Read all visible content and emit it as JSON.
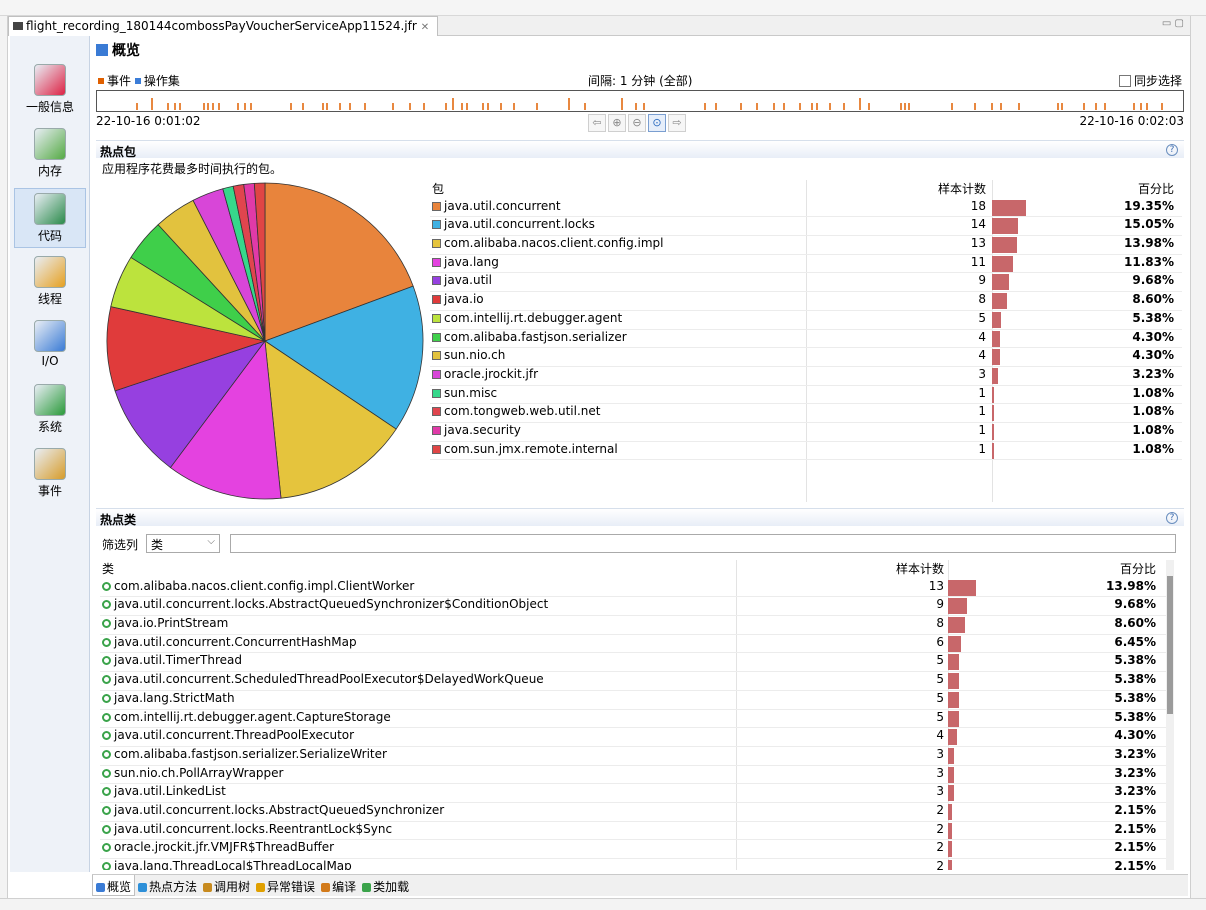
{
  "tab": {
    "title": "flight_recording_180144combossPayVoucherServiceApp11524.jfr",
    "close": "✕"
  },
  "nav": [
    {
      "label": "一般信息",
      "icon": "chart-icon"
    },
    {
      "label": "内存",
      "icon": "memory-icon"
    },
    {
      "label": "代码",
      "icon": "code-icon",
      "selected": true
    },
    {
      "label": "线程",
      "icon": "threads-icon"
    },
    {
      "label": "I/O",
      "icon": "io-icon"
    },
    {
      "label": "系统",
      "icon": "system-icon"
    },
    {
      "label": "事件",
      "icon": "events-icon"
    }
  ],
  "page": {
    "title": "概览"
  },
  "timeline": {
    "legend_events": "事件",
    "legend_opsets": "操作集",
    "interval": "间隔: 1 分钟 (全部)",
    "sync_label": "同步选择",
    "start": "22-10-16 0:01:02",
    "end": "22-10-16 0:02:03"
  },
  "hot_packages": {
    "title": "热点包",
    "description": "应用程序花费最多时间执行的包。",
    "col_package": "包",
    "col_count": "样本计数",
    "col_percent": "百分比",
    "rows": [
      {
        "name": "java.util.concurrent",
        "count": 18,
        "percent": "19.35%",
        "color": "#e8843c"
      },
      {
        "name": "java.util.concurrent.locks",
        "count": 14,
        "percent": "15.05%",
        "color": "#3fb1e3"
      },
      {
        "name": "com.alibaba.nacos.client.config.impl",
        "count": 13,
        "percent": "13.98%",
        "color": "#e5c43d"
      },
      {
        "name": "java.lang",
        "count": 11,
        "percent": "11.83%",
        "color": "#e442e0"
      },
      {
        "name": "java.util",
        "count": 9,
        "percent": "9.68%",
        "color": "#9640e0"
      },
      {
        "name": "java.io",
        "count": 8,
        "percent": "8.60%",
        "color": "#e03b3b"
      },
      {
        "name": "com.intellij.rt.debugger.agent",
        "count": 5,
        "percent": "5.38%",
        "color": "#bce33d"
      },
      {
        "name": "com.alibaba.fastjson.serializer",
        "count": 4,
        "percent": "4.30%",
        "color": "#3fcf4a"
      },
      {
        "name": "sun.nio.ch",
        "count": 4,
        "percent": "4.30%",
        "color": "#e2c23e"
      },
      {
        "name": "oracle.jrockit.jfr",
        "count": 3,
        "percent": "3.23%",
        "color": "#d846d8"
      },
      {
        "name": "sun.misc",
        "count": 1,
        "percent": "1.08%",
        "color": "#36d88b"
      },
      {
        "name": "com.tongweb.web.util.net",
        "count": 1,
        "percent": "1.08%",
        "color": "#e0454e"
      },
      {
        "name": "java.security",
        "count": 1,
        "percent": "1.08%",
        "color": "#e03aa8"
      },
      {
        "name": "com.sun.jmx.remote.internal",
        "count": 1,
        "percent": "1.08%",
        "color": "#e04545"
      }
    ]
  },
  "hot_classes": {
    "title": "热点类",
    "filter_label": "筛选列",
    "filter_value": "类",
    "col_class": "类",
    "col_count": "样本计数",
    "col_percent": "百分比",
    "rows": [
      {
        "name": "com.alibaba.nacos.client.config.impl.ClientWorker",
        "count": 13,
        "percent": "13.98%"
      },
      {
        "name": "java.util.concurrent.locks.AbstractQueuedSynchronizer$ConditionObject",
        "count": 9,
        "percent": "9.68%"
      },
      {
        "name": "java.io.PrintStream",
        "count": 8,
        "percent": "8.60%"
      },
      {
        "name": "java.util.concurrent.ConcurrentHashMap",
        "count": 6,
        "percent": "6.45%"
      },
      {
        "name": "java.util.TimerThread",
        "count": 5,
        "percent": "5.38%"
      },
      {
        "name": "java.util.concurrent.ScheduledThreadPoolExecutor$DelayedWorkQueue",
        "count": 5,
        "percent": "5.38%"
      },
      {
        "name": "java.lang.StrictMath",
        "count": 5,
        "percent": "5.38%"
      },
      {
        "name": "com.intellij.rt.debugger.agent.CaptureStorage",
        "count": 5,
        "percent": "5.38%"
      },
      {
        "name": "java.util.concurrent.ThreadPoolExecutor",
        "count": 4,
        "percent": "4.30%"
      },
      {
        "name": "com.alibaba.fastjson.serializer.SerializeWriter",
        "count": 3,
        "percent": "3.23%"
      },
      {
        "name": "sun.nio.ch.PollArrayWrapper",
        "count": 3,
        "percent": "3.23%"
      },
      {
        "name": "java.util.LinkedList",
        "count": 3,
        "percent": "3.23%"
      },
      {
        "name": "java.util.concurrent.locks.AbstractQueuedSynchronizer",
        "count": 2,
        "percent": "2.15%"
      },
      {
        "name": "java.util.concurrent.locks.ReentrantLock$Sync",
        "count": 2,
        "percent": "2.15%"
      },
      {
        "name": "oracle.jrockit.jfr.VMJFR$ThreadBuffer",
        "count": 2,
        "percent": "2.15%"
      },
      {
        "name": "java.lang.ThreadLocal$ThreadLocalMap",
        "count": 2,
        "percent": "2.15%"
      }
    ]
  },
  "bottom_tabs": [
    {
      "label": "概览",
      "icon": "overview-icon",
      "selected": true
    },
    {
      "label": "热点方法",
      "icon": "hot-methods-icon"
    },
    {
      "label": "调用树",
      "icon": "call-tree-icon"
    },
    {
      "label": "异常错误",
      "icon": "exceptions-icon"
    },
    {
      "label": "编译",
      "icon": "compile-icon"
    },
    {
      "label": "类加载",
      "icon": "class-loading-icon"
    }
  ],
  "colors": {
    "bar": "#c8676a",
    "event": "#e06000",
    "opset": "#3b7dd8"
  }
}
